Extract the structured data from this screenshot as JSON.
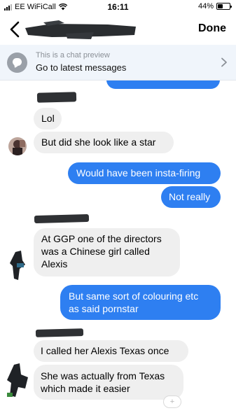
{
  "status_bar": {
    "carrier": "EE WiFiCall",
    "time": "16:11",
    "battery_percent": "44%",
    "battery_level": 0.44,
    "signal_icon": "signal-bars-icon",
    "wifi_icon": "wifi-icon"
  },
  "nav": {
    "back_icon": "chevron-left-icon",
    "done_label": "Done"
  },
  "banner": {
    "note": "This is a chat preview",
    "link": "Go to latest messages",
    "icon": "chat-bubble-icon",
    "chevron_icon": "chevron-right-icon"
  },
  "messages": [
    {
      "side": "in",
      "text": "Lol"
    },
    {
      "side": "in",
      "text": "But did she look like a star"
    },
    {
      "side": "out",
      "text": "Would have been insta-firing"
    },
    {
      "side": "out",
      "text": "Not really"
    },
    {
      "side": "in",
      "text": "At GGP one of the directors\nwas a Chinese girl called\nAlexis"
    },
    {
      "side": "out",
      "text": "But same sort of colouring etc\nas said pornstar"
    },
    {
      "side": "in",
      "text": "I called her Alexis Texas once"
    },
    {
      "side": "in",
      "text": "She was actually from Texas\nwhich made it easier"
    }
  ],
  "reaction_button": {
    "icon": "add-reaction-icon",
    "label": "+"
  },
  "colors": {
    "outgoing_bubble": "#2e7ff1",
    "incoming_bubble": "#efefef",
    "banner_bg": "#f0f5fb"
  }
}
